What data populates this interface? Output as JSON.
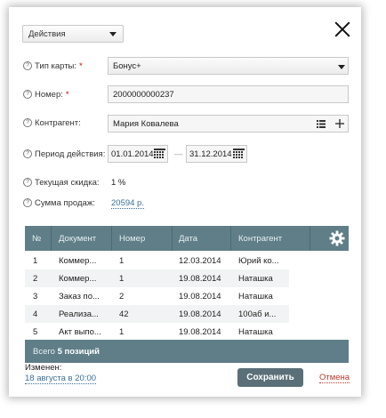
{
  "header": {
    "actions_label": "Действия",
    "close_icon": "close-icon"
  },
  "form": {
    "card_type": {
      "label": "Тип карты:",
      "required_mark": "*",
      "value": "Бонус+"
    },
    "number": {
      "label": "Номер:",
      "required_mark": "*",
      "value": "2000000000237"
    },
    "counterparty": {
      "label": "Контрагент:",
      "value": "Мария Ковалева"
    },
    "period": {
      "label": "Период действия:",
      "from": "01.01.2014",
      "to": "31.12.2014",
      "dash": "—"
    },
    "discount": {
      "label": "Текущая скидка:",
      "value": "1 %"
    },
    "sales_total": {
      "label": "Сумма продаж:",
      "value": "20594 р."
    }
  },
  "table": {
    "columns": [
      "№",
      "Документ",
      "Номер",
      "Дата",
      "Контрагент"
    ],
    "rows": [
      [
        "1",
        "Коммер...",
        "1",
        "12.03.2014",
        "Юрий ко..."
      ],
      [
        "2",
        "Коммер...",
        "1",
        "19.08.2014",
        "Наташка"
      ],
      [
        "3",
        "Заказ по...",
        "2",
        "19.08.2014",
        "Наташка"
      ],
      [
        "4",
        "Реализа...",
        "42",
        "19.08.2014",
        "100аб и..."
      ],
      [
        "5",
        "Акт выпо...",
        "1",
        "19.08.2014",
        "Наташка"
      ]
    ]
  },
  "summary": {
    "prefix": "Всего",
    "count": "5 позиций"
  },
  "bottom": {
    "changed_label": "Изменен:",
    "changed_value": "18 августа в 20:00",
    "save_label": "Сохранить",
    "cancel_label": "Отмена"
  },
  "colors": {
    "header_bg": "#5f7e88",
    "save_bg": "#5a6f78",
    "cancel": "#c0392b",
    "link": "#3a6f96"
  }
}
